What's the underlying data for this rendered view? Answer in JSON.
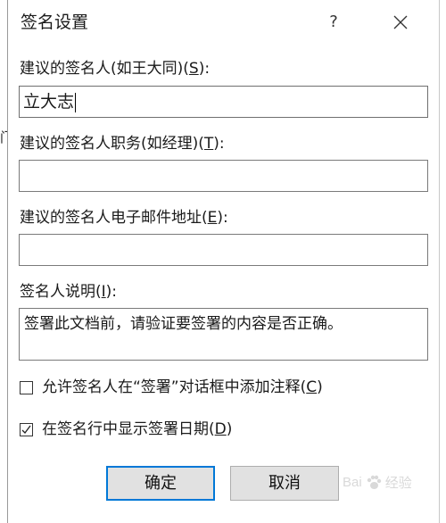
{
  "dialog": {
    "title": "签名设置",
    "help_glyph": "?",
    "close_glyph": "×"
  },
  "left_edge": {
    "fragment": "门"
  },
  "fields": {
    "signer_name": {
      "label_pre": "建议的签名人(如王大同)(",
      "label_key": "S",
      "label_post": "):",
      "value": "立大志"
    },
    "signer_title": {
      "label_pre": "建议的签名人职务(如经理)(",
      "label_key": "T",
      "label_post": "):",
      "value": ""
    },
    "signer_email": {
      "label_pre": "建议的签名人电子邮件地址(",
      "label_key": "E",
      "label_post": "):",
      "value": ""
    },
    "instructions": {
      "label_pre": "签名人说明(",
      "label_key": "I",
      "label_post": "):",
      "value": "签署此文档前，请验证要签署的内容是否正确。"
    }
  },
  "options": {
    "allow_comments": {
      "label_pre": "允许签名人在“签署”对话框中添加注释(",
      "label_key": "C",
      "label_post": ")",
      "checked": false
    },
    "show_date": {
      "label_pre": "在签名行中显示签署日期(",
      "label_key": "D",
      "label_post": ")",
      "checked": true
    }
  },
  "buttons": {
    "ok": "确定",
    "cancel": "取消"
  },
  "watermark": {
    "text": "Bai",
    "suffix": "经验"
  },
  "colors": {
    "accent": "#0078d7",
    "button_bg": "#e1e1e1",
    "border": "#7a7a7a"
  }
}
